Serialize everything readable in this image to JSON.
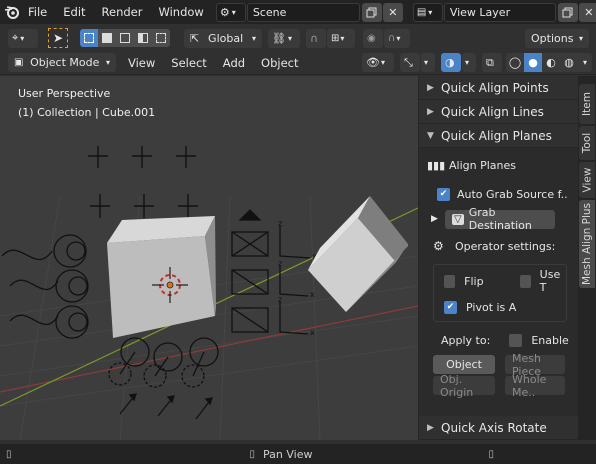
{
  "menu": [
    "File",
    "Edit",
    "Render",
    "Window"
  ],
  "scene": {
    "name": "Scene"
  },
  "view_layer": {
    "name": "View Layer"
  },
  "toolbar": {
    "orientation": "Global",
    "options": "Options"
  },
  "header": {
    "mode": "Object Mode",
    "menus": [
      "View",
      "Select",
      "Add",
      "Object"
    ]
  },
  "viewport": {
    "perspective": "User Perspective",
    "collection": "(1) Collection | Cube.001"
  },
  "panel": {
    "sections": {
      "points": "Quick Align Points",
      "lines": "Quick Align Lines",
      "planes": "Quick Align Planes",
      "axis": "Quick Axis Rotate"
    },
    "align_planes_label": "Align Planes",
    "auto_grab": "Auto Grab Source f..",
    "grab_dest": "Grab Destination",
    "operator_settings": "Operator settings:",
    "flip": "Flip",
    "use_t": "Use T",
    "pivot": "Pivot is A",
    "apply_to": "Apply to:",
    "enable": "Enable",
    "object_btn": "Object",
    "mesh_piece_btn": "Mesh Piece",
    "obj_origin_btn": "Obj. Origin",
    "whole_mesh_btn": "Whole Me.."
  },
  "tabs": [
    "Item",
    "Tool",
    "View",
    "Mesh Align Plus"
  ],
  "status": {
    "text": "Pan View"
  },
  "colors": {
    "accent": "#4a84c6",
    "checkbox_on": "#4a84c6",
    "origin": "#e07020"
  }
}
